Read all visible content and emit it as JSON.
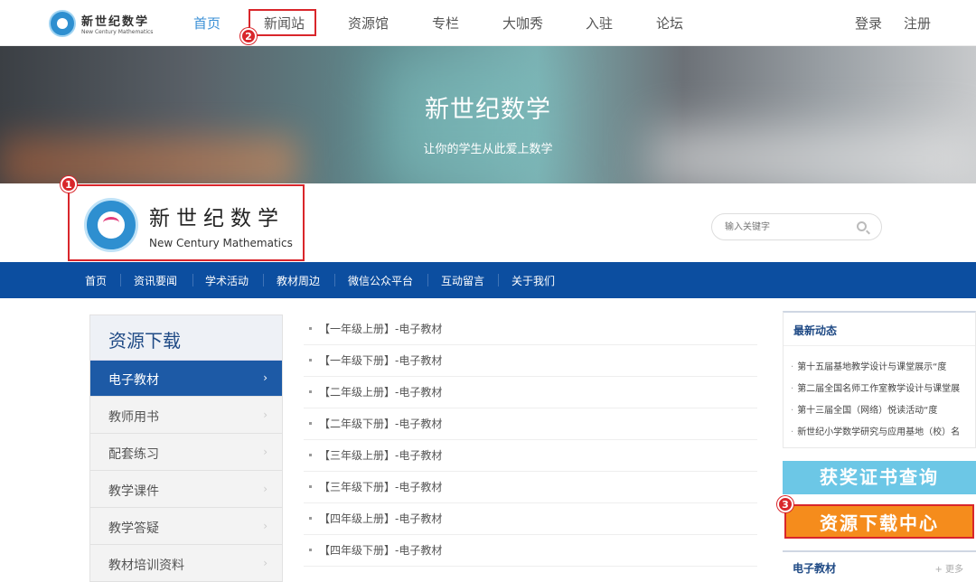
{
  "topnav": {
    "logo_cn": "新世纪数学",
    "logo_en": "New Century Mathematics",
    "items": [
      "首页",
      "新闻站",
      "资源馆",
      "专栏",
      "大咖秀",
      "入驻",
      "论坛"
    ],
    "login": "登录",
    "register": "注册"
  },
  "annotations": [
    "1",
    "2",
    "3"
  ],
  "banner": {
    "title": "新世纪数学",
    "subtitle": "让你的学生从此爱上数学"
  },
  "site_header": {
    "logo_cn": "新世纪数学",
    "logo_en": "New Century Mathematics",
    "search_placeholder": "输入关键字"
  },
  "menu": [
    "首页",
    "资讯要闻",
    "学术活动",
    "教材周边",
    "微信公众平台",
    "互动留言",
    "关于我们"
  ],
  "sidebar": {
    "title": "资源下载",
    "items": [
      "电子教材",
      "教师用书",
      "配套练习",
      "教学课件",
      "教学答疑",
      "教材培训资料"
    ],
    "chevron": "›"
  },
  "resources": [
    "【一年级上册】-电子教材",
    "【一年级下册】-电子教材",
    "【二年级上册】-电子教材",
    "【二年级下册】-电子教材",
    "【三年级上册】-电子教材",
    "【三年级下册】-电子教材",
    "【四年级上册】-电子教材",
    "【四年级下册】-电子教材"
  ],
  "news": {
    "title": "最新动态",
    "items": [
      "第十五届基地教学设计与课堂展示“度",
      "第二届全国名师工作室教学设计与课堂展",
      "第十三届全国（网络）悦读活动“度",
      "新世纪小学数学研究与应用基地（校）名"
    ]
  },
  "buttons": {
    "certificate": "获奖证书查询",
    "download_center": "资源下载中心"
  },
  "resource_panel": {
    "title": "电子教材",
    "more": "+ 更多"
  },
  "colors": {
    "primary_blue": "#0c4ea0",
    "active_blue": "#1d5aa6",
    "annotation_red": "#d9262b",
    "download_orange": "#f58c1c",
    "certificate_cyan": "#6cc7e6"
  }
}
